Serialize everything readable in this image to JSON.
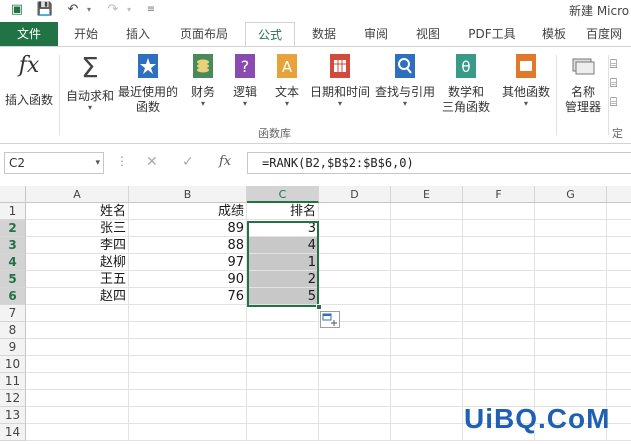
{
  "titlebar": {
    "doc_title": "新建 Micro"
  },
  "tabs": {
    "file": "文件",
    "items": [
      {
        "label": "开始"
      },
      {
        "label": "插入"
      },
      {
        "label": "页面布局"
      },
      {
        "label": "公式"
      },
      {
        "label": "数据"
      },
      {
        "label": "审阅"
      },
      {
        "label": "视图"
      },
      {
        "label": "PDF工具"
      },
      {
        "label": "模板"
      },
      {
        "label": "百度网"
      }
    ],
    "active": "公式"
  },
  "ribbon": {
    "insert_function": "插入函数",
    "autosum": "自动求和",
    "recent_line1": "最近使用的",
    "recent_line2": "函数",
    "financial": "财务",
    "logical": "逻辑",
    "text": "文本",
    "datetime": "日期和时间",
    "lookup": "查找与引用",
    "math_line1": "数学和",
    "math_line2": "三角函数",
    "more": "其他函数",
    "name_mgr_line1": "名称",
    "name_mgr_line2": "管理器",
    "group_label": "函数库",
    "group_label_2": "定"
  },
  "formula_bar": {
    "name_box": "C2",
    "fx": "fx",
    "formula": "=RANK(B2,$B$2:$B$6,0)"
  },
  "grid": {
    "columns": [
      "A",
      "B",
      "C",
      "D",
      "E",
      "F",
      "G"
    ],
    "rows": [
      "1",
      "2",
      "3",
      "4",
      "5",
      "6",
      "7",
      "8",
      "9",
      "10",
      "11",
      "12",
      "13",
      "14"
    ],
    "header_row": {
      "A": "姓名",
      "B": "成绩",
      "C": "排名"
    },
    "data": [
      {
        "name": "张三",
        "score": "89",
        "rank": "3"
      },
      {
        "name": "李四",
        "score": "88",
        "rank": "4"
      },
      {
        "name": "赵柳",
        "score": "97",
        "rank": "1"
      },
      {
        "name": "王五",
        "score": "90",
        "rank": "2"
      },
      {
        "name": "赵四",
        "score": "76",
        "rank": "5"
      }
    ]
  },
  "watermark": "UiBQ.CoM",
  "colors": {
    "accent": "#217346",
    "selection_fill": "#c8c8c8",
    "watermark": "#1f5fb4"
  }
}
